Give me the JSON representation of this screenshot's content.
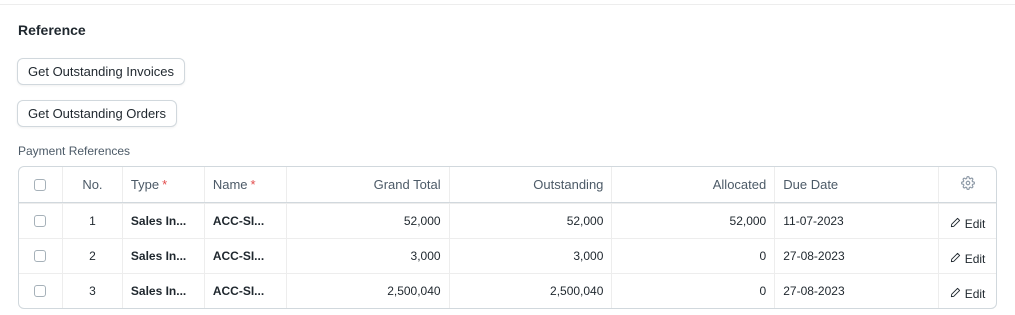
{
  "section": {
    "title": "Reference"
  },
  "buttons": {
    "get_outstanding_invoices": "Get Outstanding Invoices",
    "get_outstanding_orders": "Get Outstanding Orders"
  },
  "payment_references": {
    "label": "Payment References",
    "columns": {
      "no": "No.",
      "type": "Type",
      "name": "Name",
      "grand_total": "Grand Total",
      "outstanding": "Outstanding",
      "allocated": "Allocated",
      "due_date": "Due Date",
      "required_marker": "*"
    },
    "edit_label": "Edit",
    "rows": [
      {
        "no": "1",
        "type": "Sales In...",
        "name": "ACC-SI...",
        "grand_total": "52,000",
        "outstanding": "52,000",
        "allocated": "52,000",
        "due_date": "11-07-2023"
      },
      {
        "no": "2",
        "type": "Sales In...",
        "name": "ACC-SI...",
        "grand_total": "3,000",
        "outstanding": "3,000",
        "allocated": "0",
        "due_date": "27-08-2023"
      },
      {
        "no": "3",
        "type": "Sales In...",
        "name": "ACC-SI...",
        "grand_total": "2,500,040",
        "outstanding": "2,500,040",
        "allocated": "0",
        "due_date": "27-08-2023"
      }
    ]
  },
  "icons": {
    "settings": "gear-icon",
    "edit": "pencil-icon"
  },
  "colors": {
    "required": "#e24c4c",
    "border": "#d1d8dd",
    "text": "#1f272e",
    "muted": "#4c5a67"
  }
}
